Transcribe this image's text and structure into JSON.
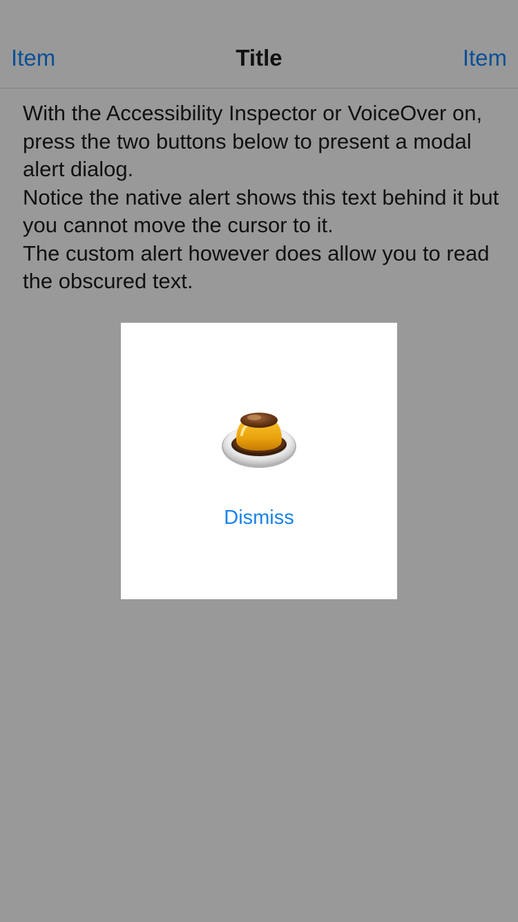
{
  "navbar": {
    "left_item": "Item",
    "title": "Title",
    "right_item": "Item"
  },
  "body": {
    "paragraphs": [
      "With the Accessibility Inspector or VoiceOver on, press the two buttons below to present a modal alert dialog.",
      "Notice the native alert shows this text behind it but you cannot move the cursor to it.",
      "The custom alert however does allow you to read the obscured text."
    ]
  },
  "alert": {
    "icon": "custard-pudding-icon",
    "dismiss_label": "Dismiss"
  },
  "colors": {
    "background": "#999999",
    "nav_accent": "#0a4f96",
    "alert_background": "#ffffff",
    "dismiss_accent": "#1a82e8"
  }
}
